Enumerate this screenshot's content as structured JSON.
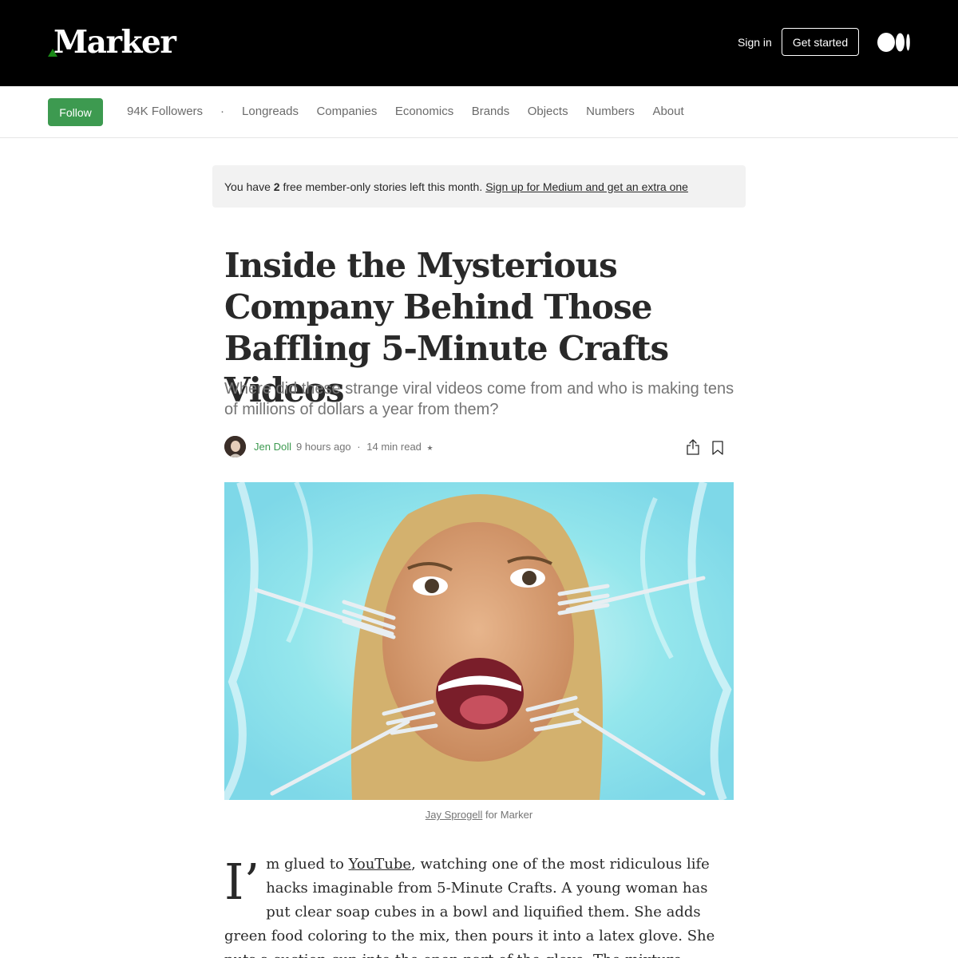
{
  "header": {
    "logo_text": "Marker",
    "sign_in": "Sign in",
    "get_started": "Get started",
    "brand_accent": "#1a8917"
  },
  "nav": {
    "follow": "Follow",
    "followers": "94K Followers",
    "separator": "·",
    "links": [
      "Longreads",
      "Companies",
      "Economics",
      "Brands",
      "Objects",
      "Numbers",
      "About"
    ]
  },
  "banner": {
    "prefix": "You have",
    "count": "2",
    "suffix": "free member-only stories left this month.",
    "link": "Sign up for Medium and get an extra one"
  },
  "article": {
    "title": "Inside the Mysterious Company Behind Those Baffling 5-Minute Crafts Videos",
    "subtitle": "Where did these strange viral videos come from and who is making tens of millions of dollars a year from them?",
    "author": "Jen Doll",
    "posted": "9 hours ago",
    "dot": "·",
    "read_time": "14 min read",
    "star": "★",
    "caption_credit": "Jay Sprogell",
    "caption_suffix": "for Marker",
    "dropcap": "I’",
    "body_before_link": "m glued to ",
    "body_link": "YouTube",
    "body_after_link": ", watching one of the most ridiculous life hacks imaginable from 5-Minute Crafts. A young woman has put clear soap cubes in a bowl and liquified them. She adds green food coloring to the mix, then pours it into a latex glove. She puts a suction cup into the open part of the glove. The mixture solidifies, and..."
  },
  "colors": {
    "follow_green": "#3d9a50",
    "author_green": "#3d9a50",
    "hero_bg": "#8ee3ea"
  }
}
